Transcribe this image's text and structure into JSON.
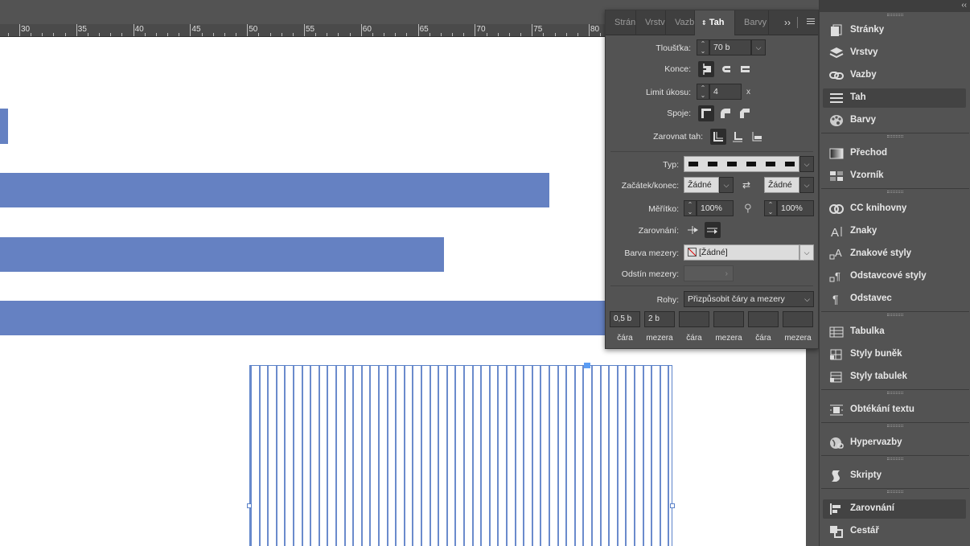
{
  "ruler": {
    "labels": [
      "30",
      "35",
      "40",
      "45",
      "50",
      "55",
      "60",
      "65",
      "70",
      "75",
      "80"
    ]
  },
  "panel": {
    "tabs": [
      {
        "label": "Strán",
        "active": false
      },
      {
        "label": "Vrstv",
        "active": false
      },
      {
        "label": "Vazb",
        "active": false
      },
      {
        "label": "Tah",
        "active": true
      },
      {
        "label": "Barvy",
        "active": false
      }
    ],
    "tab_overflow": "››",
    "weight": {
      "label": "Tloušťka:",
      "value": "70 b"
    },
    "cap": {
      "label": "Konce:"
    },
    "miter": {
      "label": "Limit úkosu:",
      "value": "4",
      "suffix": "x"
    },
    "join": {
      "label": "Spoje:"
    },
    "align": {
      "label": "Zarovnat tah:"
    },
    "type": {
      "label": "Typ:"
    },
    "start_end": {
      "label": "Začátek/konec:",
      "start_value": "Žádné",
      "end_value": "Žádné"
    },
    "scale": {
      "label": "Měřítko:",
      "start_value": "100%",
      "end_value": "100%"
    },
    "alignment": {
      "label": "Zarovnání:"
    },
    "gap_color": {
      "label": "Barva mezery:",
      "value": "[Žádné]"
    },
    "gap_tint": {
      "label": "Odstín mezery:",
      "arrow": "›"
    },
    "corners": {
      "label": "Rohy:",
      "value": "Přizpůsobit čáry a mezery"
    },
    "dashes": [
      {
        "value": "0,5 b",
        "label": "čára"
      },
      {
        "value": "2 b",
        "label": "mezera"
      },
      {
        "value": "",
        "label": "čára"
      },
      {
        "value": "",
        "label": "mezera"
      },
      {
        "value": "",
        "label": "čára"
      },
      {
        "value": "",
        "label": "mezera"
      }
    ]
  },
  "dock": {
    "collapse": "‹‹",
    "items": [
      {
        "label": "Stránky",
        "icon": "pages-icon",
        "active": false
      },
      {
        "label": "Vrstvy",
        "icon": "layers-icon",
        "active": false
      },
      {
        "label": "Vazby",
        "icon": "links-icon",
        "active": false
      },
      {
        "label": "Tah",
        "icon": "stroke-icon",
        "active": true
      },
      {
        "label": "Barvy",
        "icon": "swatches-icon",
        "active": false
      },
      {
        "label": "Přechod",
        "icon": "gradient-icon",
        "active": false
      },
      {
        "label": "Vzorník",
        "icon": "swatch-grid-icon",
        "active": false
      },
      {
        "label": "CC knihovny",
        "icon": "cc-libraries-icon",
        "active": false
      },
      {
        "label": "Znaky",
        "icon": "character-icon",
        "active": false
      },
      {
        "label": "Znakové styly",
        "icon": "character-styles-icon",
        "active": false
      },
      {
        "label": "Odstavcové styly",
        "icon": "paragraph-styles-icon",
        "active": false
      },
      {
        "label": "Odstavec",
        "icon": "paragraph-icon",
        "active": false
      },
      {
        "label": "Tabulka",
        "icon": "table-icon",
        "active": false
      },
      {
        "label": "Styly buněk",
        "icon": "cell-styles-icon",
        "active": false
      },
      {
        "label": "Styly tabulek",
        "icon": "table-styles-icon",
        "active": false
      },
      {
        "label": "Obtékání textu",
        "icon": "text-wrap-icon",
        "active": false
      },
      {
        "label": "Hypervazby",
        "icon": "hyperlinks-icon",
        "active": false
      },
      {
        "label": "Skripty",
        "icon": "scripts-icon",
        "active": false
      },
      {
        "label": "Zarovnání",
        "icon": "align-icon",
        "active": true
      },
      {
        "label": "Cestář",
        "icon": "pathfinder-icon",
        "active": false
      }
    ]
  },
  "colors": {
    "bar_fill": "#6581c2",
    "panel_bg": "#535353",
    "selection": "#5b82c9"
  }
}
